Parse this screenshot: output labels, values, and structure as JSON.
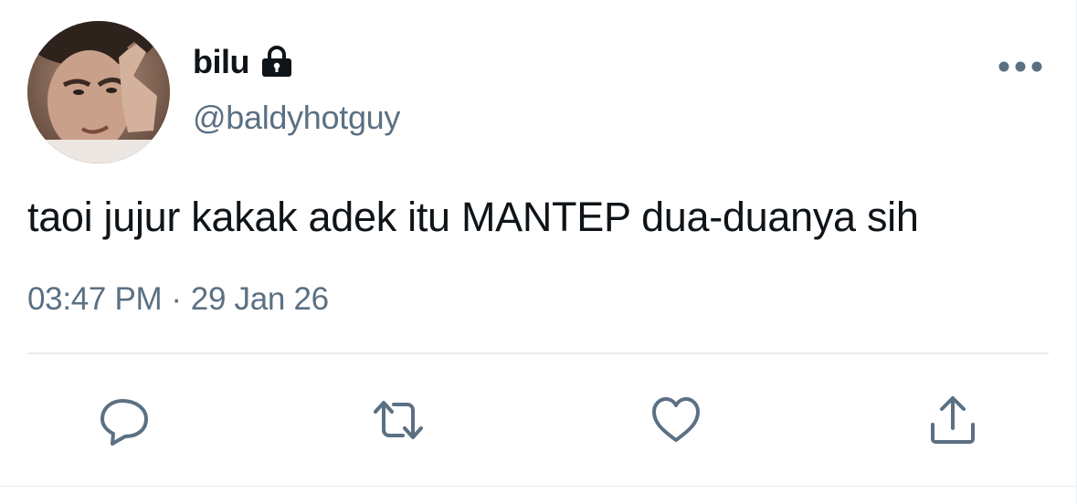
{
  "tweet": {
    "author": {
      "display_name": "bilu",
      "handle": "@baldyhotguy",
      "protected_icon": "lock-icon"
    },
    "text": "taoi jujur kakak adek itu MANTEP dua-duanya sih",
    "time": "03:47 PM",
    "separator": "·",
    "date": "29 Jan 26"
  },
  "icons": {
    "more": "more-dots-icon",
    "reply": "reply-bubble-icon",
    "retweet": "retweet-icon",
    "like": "heart-icon",
    "share": "share-upload-icon"
  },
  "colors": {
    "text_primary": "#0f1419",
    "text_secondary": "#5b7083",
    "icon_gray": "#5b7083",
    "divider": "#e6ecf0",
    "background": "#ffffff"
  }
}
